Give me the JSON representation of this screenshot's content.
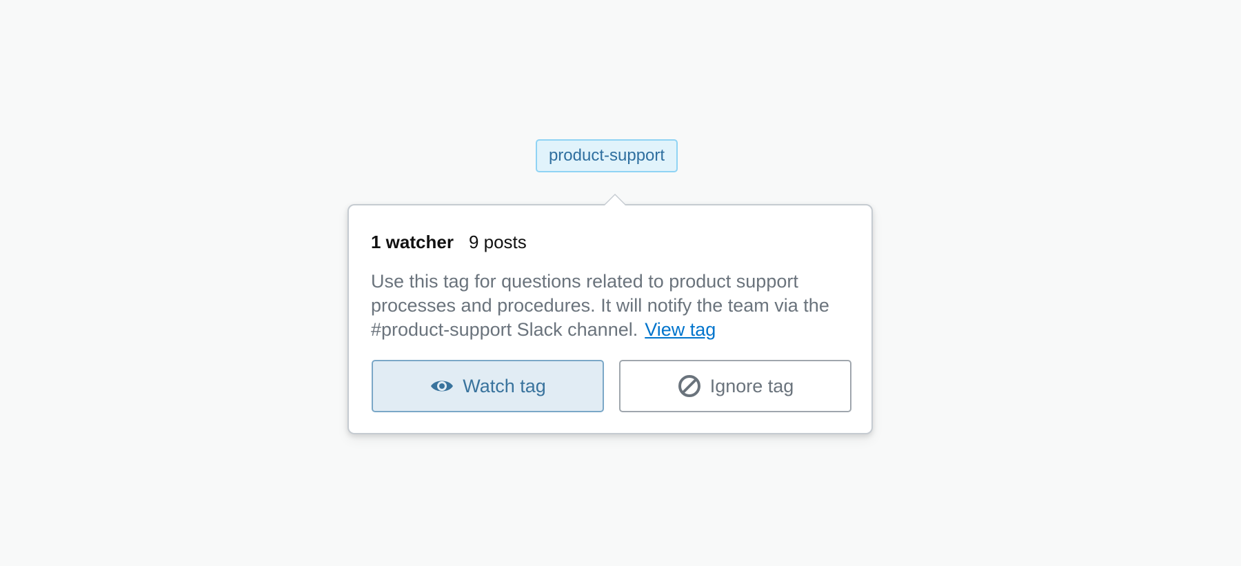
{
  "tag": {
    "name": "product-support"
  },
  "popover": {
    "watchers_label": "1 watcher",
    "posts_label": "9 posts",
    "description": "Use this tag for questions related to product support processes and procedures. It will notify the team via the #product-support Slack channel.",
    "view_link": "View tag",
    "watch_button": {
      "label": "Watch tag",
      "icon": "eye-icon"
    },
    "ignore_button": {
      "label": "Ignore tag",
      "icon": "ban-icon"
    }
  },
  "colors": {
    "background": "#f8f9f9",
    "tag_fill": "#e1f3fb",
    "tag_border": "#8fd3f4",
    "tag_text": "#2f6f9f",
    "link": "#0074cc",
    "watch_fill": "#e1ecf4",
    "watch_text": "#39739d",
    "muted_text": "#6a737c"
  }
}
